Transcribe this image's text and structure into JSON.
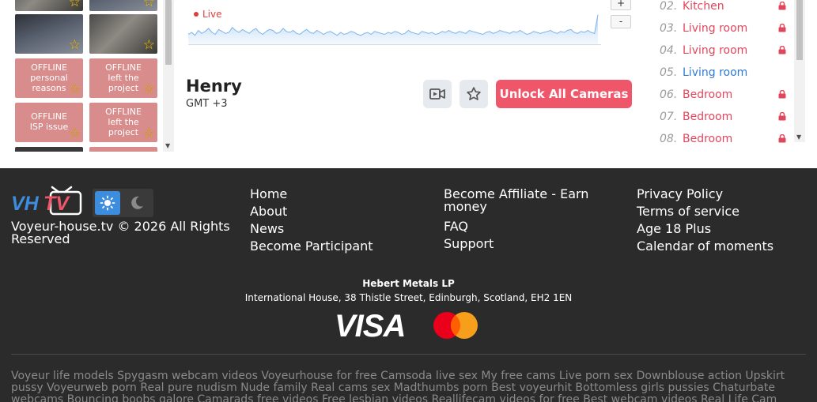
{
  "thumbnails": [
    {
      "type": "photo"
    },
    {
      "type": "photo"
    },
    {
      "type": "photo"
    },
    {
      "type": "photo"
    },
    {
      "type": "offline",
      "status": "OFFLINE",
      "reason": "personal reasons"
    },
    {
      "type": "offline",
      "status": "OFFLINE",
      "reason": "left the project"
    },
    {
      "type": "offline",
      "status": "OFFLINE",
      "reason": "ISP issue"
    },
    {
      "type": "offline",
      "status": "OFFLINE",
      "reason": "left the project"
    }
  ],
  "chart": {
    "live_label": "Live",
    "zoom_in": "+",
    "zoom_out": "-"
  },
  "chart_data": {
    "type": "area",
    "series_color": "#7cb4ea",
    "description_values": [
      10,
      12,
      9,
      14,
      11,
      13,
      16,
      12,
      10,
      15,
      13,
      11,
      12,
      17,
      14,
      12,
      15,
      13,
      11,
      14,
      16,
      12,
      10,
      13,
      15,
      14,
      11,
      12,
      16,
      13,
      12,
      14,
      11,
      10,
      13,
      15,
      12,
      11,
      14,
      12,
      10,
      12,
      13,
      11,
      9,
      12,
      10,
      11,
      13,
      12,
      10,
      9,
      11,
      12,
      10,
      13,
      12,
      11,
      10,
      12,
      11,
      13,
      12,
      10,
      11,
      14,
      12,
      11,
      10,
      13,
      12,
      11,
      12,
      10,
      11,
      13,
      12,
      14,
      12,
      11,
      13,
      12,
      11,
      14,
      13,
      12,
      11,
      10,
      12,
      13,
      11,
      12,
      14,
      13,
      12,
      11,
      13,
      12,
      14,
      12,
      10,
      11,
      13,
      12,
      11,
      12,
      13,
      14,
      12,
      11,
      13,
      12,
      14,
      15,
      12,
      11,
      13,
      12,
      14,
      12,
      11,
      30
    ]
  },
  "person": {
    "name": "Henry",
    "timezone": "GMT +3"
  },
  "actions": {
    "unlock_label": "Unlock All Cameras"
  },
  "rooms": [
    {
      "num": "02.",
      "label": "Kitchen",
      "locked": true
    },
    {
      "num": "03.",
      "label": "Living room",
      "locked": true
    },
    {
      "num": "04.",
      "label": "Living room",
      "locked": true
    },
    {
      "num": "05.",
      "label": "Living room",
      "locked": false
    },
    {
      "num": "06.",
      "label": "Bedroom",
      "locked": true
    },
    {
      "num": "07.",
      "label": "Bedroom",
      "locked": true
    },
    {
      "num": "08.",
      "label": "Bedroom",
      "locked": true
    }
  ],
  "footer": {
    "logo_text": "VHTV",
    "copyright": "Voyeur-house.tv © 2026 All Rights Reserved",
    "col1": [
      "Home",
      "About",
      "News",
      "Become Participant"
    ],
    "col2": [
      "Become Affiliate - Earn money",
      "FAQ",
      "Support"
    ],
    "col3": [
      "Privacy Policy",
      "Terms of service",
      "Age 18 Plus",
      "Calendar of moments"
    ],
    "company": "Hebert Metals LP",
    "address": "International House, 38 Thistle Street, Edinburgh, Scotland, EH2 1EN",
    "visa": "VISA",
    "seo_text": "Voyeur life models Spygasm webcam videos Voyeurhouse for free Camsoda live sex My free cams Live porn sex Downblouse action Upskirt pussy Voyeurweb porn Real pure nudism Nude family Real cams sex Madthumbs porn Best voyeurhit Bottomless girls pussies Chaturbate webcams Bouncing boobs galore Camarads free videos Free lesbian videos Reallifecam videos for free Best webcam videos Real Life Cam videos for free Home cam"
  },
  "colors": {
    "accent": "#f0566a",
    "locked_room": "#e0475d",
    "open_room": "#2e7bd1",
    "footer_bg": "#2b2b2b",
    "theme_active": "#3c8dde"
  }
}
